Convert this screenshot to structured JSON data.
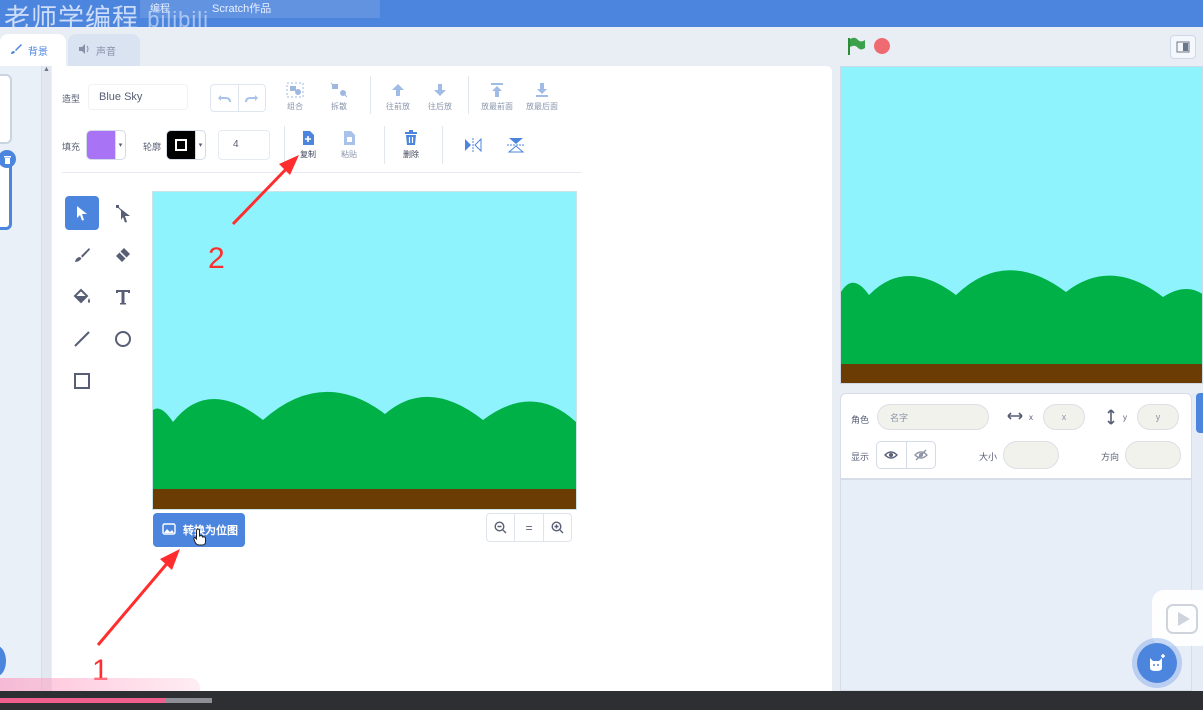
{
  "watermark": {
    "channel": "老师学编程",
    "logo": "bilibili",
    "menu_a": "编程",
    "menu_b": "Scratch作品"
  },
  "tabs": {
    "backdrops": "背景",
    "sounds": "声音"
  },
  "editor": {
    "costume_label": "造型",
    "costume_name": "Blue Sky",
    "fill_label": "填充",
    "outline_label": "轮廓",
    "outline_width": "4",
    "fill_color": "#a874f5",
    "outline_color": "#000000",
    "buttons": {
      "group": "组合",
      "ungroup": "拆散",
      "forward": "往前放",
      "backward": "往后放",
      "front": "放最前面",
      "back": "放最后面",
      "copy": "复制",
      "paste": "粘贴",
      "delete": "删除"
    },
    "convert_button": "转换为位图",
    "zoom_reset": "="
  },
  "annotations": {
    "step1": "1",
    "step2": "2",
    "color": "#ff2d2d"
  },
  "sprite_info": {
    "sprite_label": "角色",
    "name_placeholder": "名字",
    "x_label": "x",
    "x_placeholder": "x",
    "y_label": "y",
    "y_placeholder": "y",
    "show_label": "显示",
    "size_label": "大小",
    "direction_label": "方向"
  },
  "colors": {
    "accent": "#4c85dd",
    "sky": "#8ff3fd",
    "hills": "#00b147",
    "ground": "#6b3d04",
    "fill": "#a874f5"
  },
  "video": {
    "progress": 0.138
  }
}
